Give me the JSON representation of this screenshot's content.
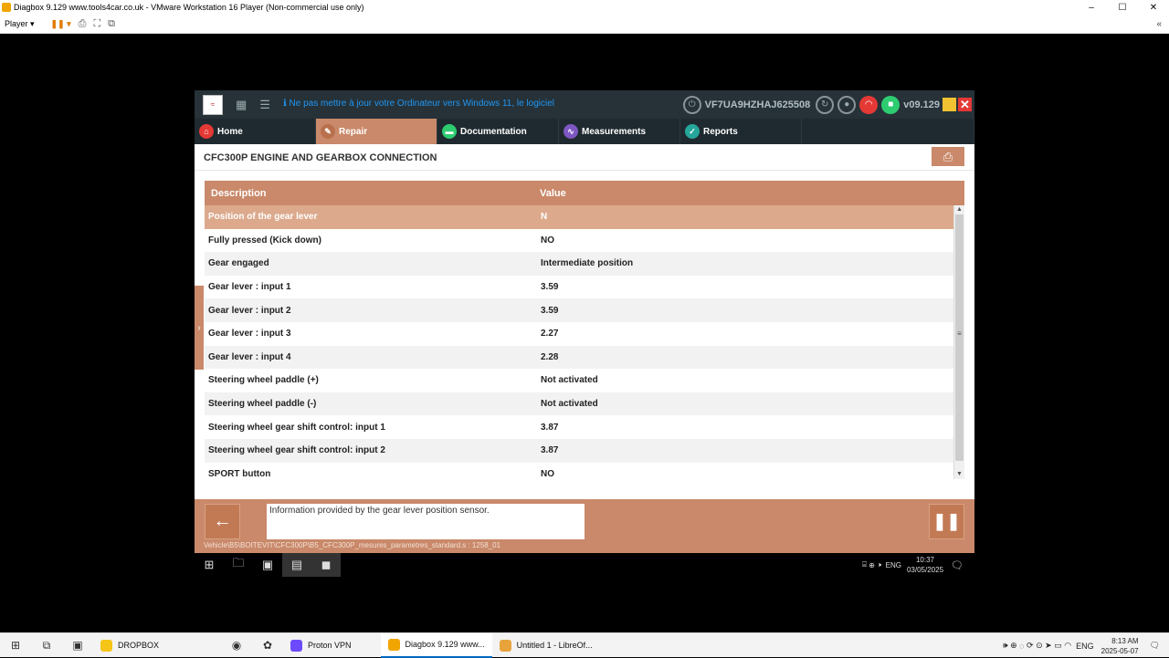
{
  "vm": {
    "title": "Diagbox 9.129 www.tools4car.co.uk - VMware Workstation 16 Player (Non-commercial use only)",
    "player_label": "Player ▾",
    "minimize": "–",
    "maximize": "☐",
    "close": "✕"
  },
  "app": {
    "notice": "Ne pas mettre à jour votre Ordinateur vers Windows 11, le logiciel DiagBox n'est pas compatible",
    "vin": "VF7UA9HZHAJ625508",
    "version": "v09.129",
    "close_label": "✕",
    "nav": [
      {
        "label": "Home",
        "icon": "home-icon",
        "color": "#e53935"
      },
      {
        "label": "Repair",
        "icon": "repair-icon",
        "color": "#c9896a"
      },
      {
        "label": "Documentation",
        "icon": "folder-icon",
        "color": "#2ecc71"
      },
      {
        "label": "Measurements",
        "icon": "waveform-icon",
        "color": "#7e57c2"
      },
      {
        "label": "Reports",
        "icon": "report-icon",
        "color": "#26a69a"
      }
    ],
    "page_title": "CFC300P ENGINE AND GEARBOX CONNECTION",
    "table": {
      "headers": [
        "Description",
        "Value"
      ],
      "rows": [
        [
          "Position of the gear lever",
          "N"
        ],
        [
          "Fully pressed (Kick down)",
          "NO"
        ],
        [
          "Gear engaged",
          "Intermediate position"
        ],
        [
          "Gear lever : input 1",
          "3.59"
        ],
        [
          "Gear lever : input 2",
          "3.59"
        ],
        [
          "Gear lever : input 3",
          "2.27"
        ],
        [
          "Gear lever : input 4",
          "2.28"
        ],
        [
          "Steering wheel paddle (+)",
          "Not activated"
        ],
        [
          "Steering wheel paddle (-)",
          "Not activated"
        ],
        [
          "Steering wheel gear shift control: input 1",
          "3.87"
        ],
        [
          "Steering wheel gear shift control: input 2",
          "3.87"
        ],
        [
          "SPORT button",
          "NO"
        ]
      ]
    },
    "info_text": "Information provided by the gear lever position sensor.",
    "path": "Vehicle\\B5\\BOITEVIT\\CFC300P\\B5_CFC300P_mesures_parametres_standard.s : 1258_01"
  },
  "guest_taskbar": {
    "lang": "ENG",
    "time": "10:37",
    "date": "03/05/2025"
  },
  "host_taskbar": {
    "apps": [
      {
        "label": "DROPBOX",
        "color": "#f5c518"
      },
      {
        "label": "Proton VPN",
        "color": "#6d4aff"
      },
      {
        "label": "Diagbox 9.129 www...",
        "color": "#f0a500"
      },
      {
        "label": "Untitled 1 - LibreOf...",
        "color": "#e8a33d"
      }
    ],
    "lang": "ENG",
    "time": "8:13 AM",
    "date": "2025-05-07"
  }
}
